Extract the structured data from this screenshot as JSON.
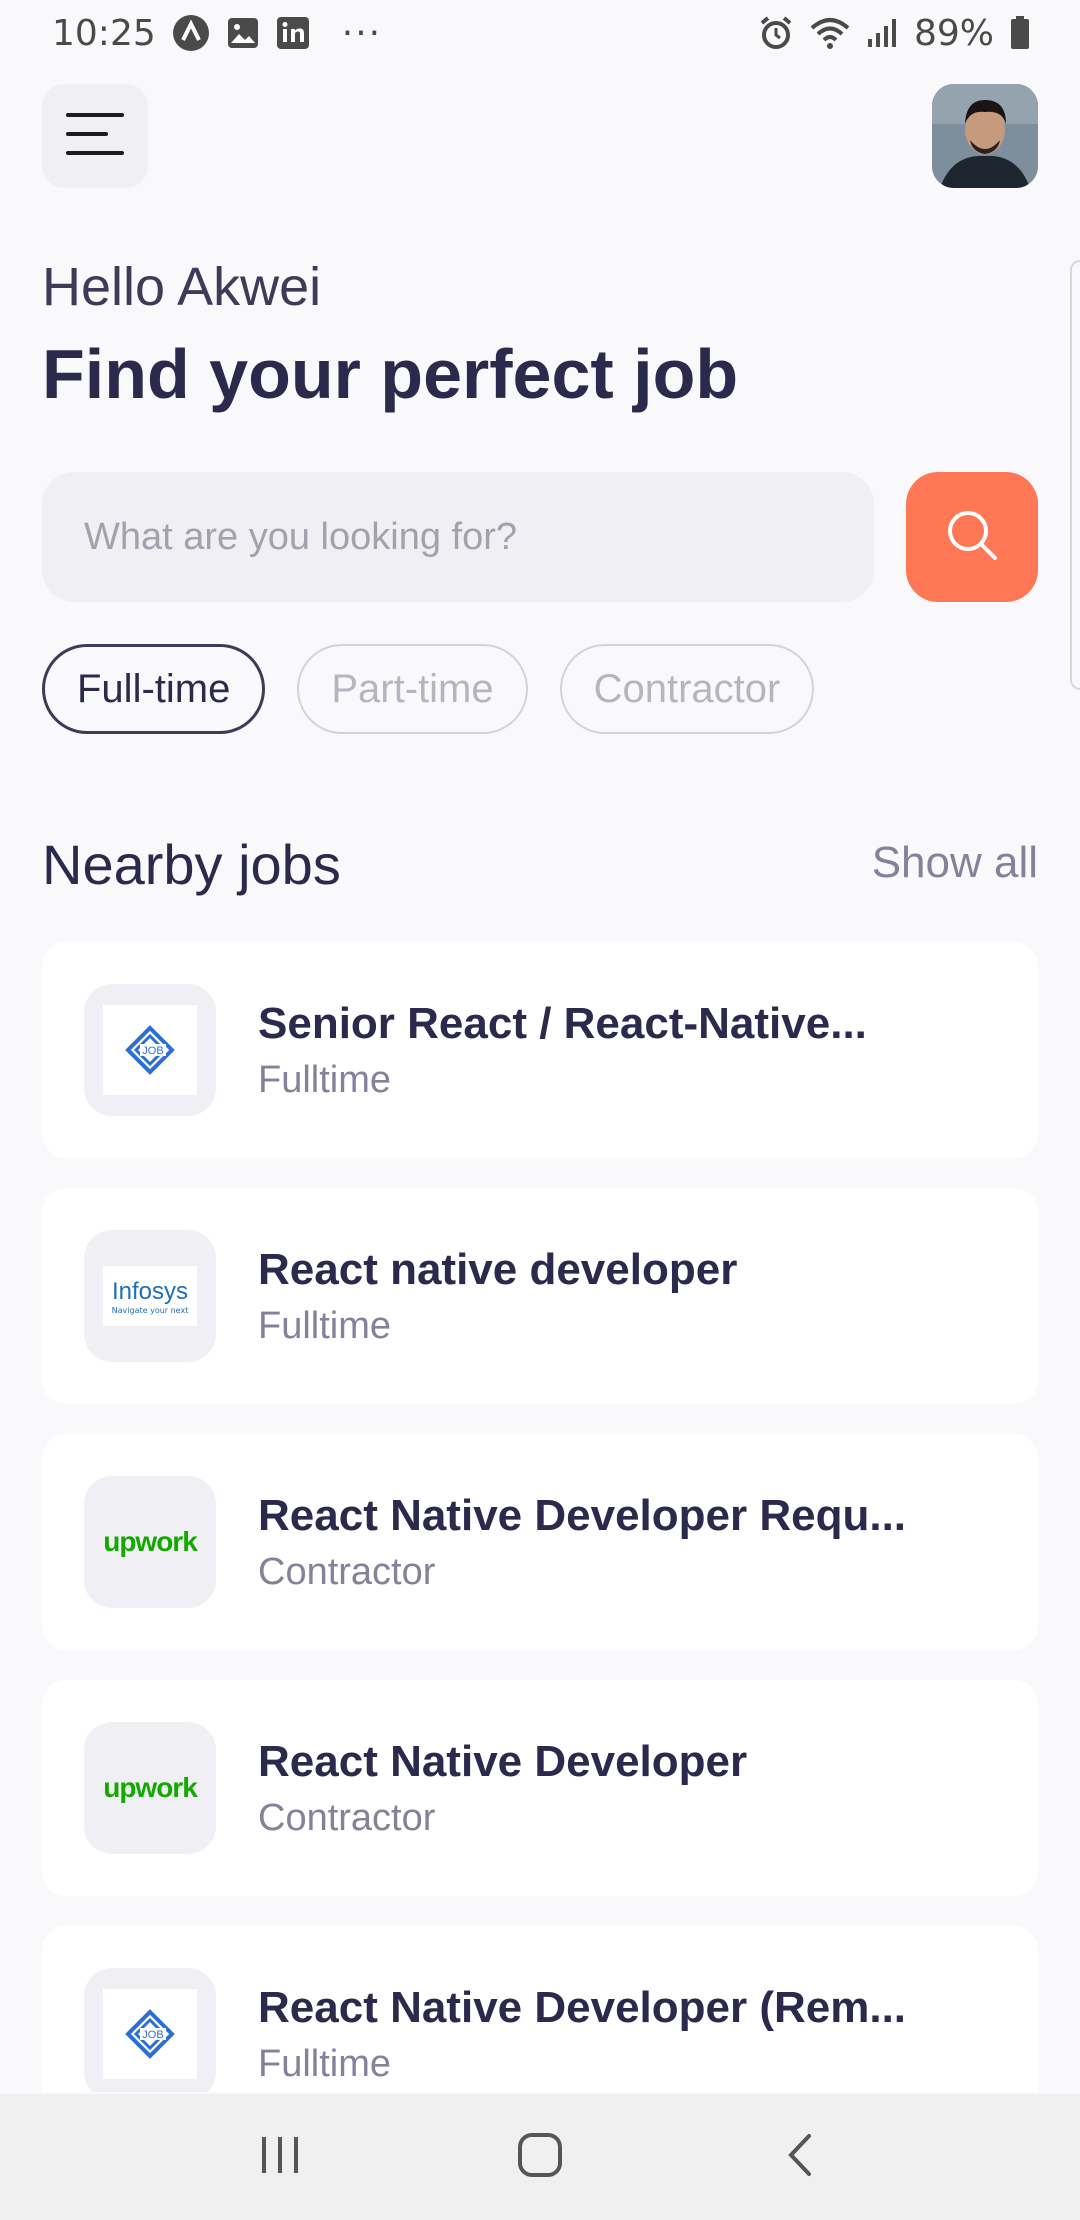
{
  "status_bar": {
    "time": "10:25",
    "dots": "···",
    "battery": "89%",
    "icons": [
      "app-icon",
      "image-icon",
      "linkedin-icon",
      "alarm-icon",
      "wifi-icon",
      "signal-icon",
      "battery-icon"
    ]
  },
  "header": {
    "menu_icon": "menu-icon",
    "avatar": "profile-avatar"
  },
  "greeting": "Hello Akwei",
  "headline": "Find your perfect job",
  "search": {
    "placeholder": "What are you looking for?",
    "value": "",
    "button_icon": "search-icon"
  },
  "chips": [
    {
      "label": "Full-time",
      "active": true
    },
    {
      "label": "Part-time",
      "active": false
    },
    {
      "label": "Contractor",
      "active": false
    }
  ],
  "section": {
    "title": "Nearby jobs",
    "show_all": "Show all"
  },
  "jobs": [
    {
      "title": "Senior React / React-Native...",
      "type": "Fulltime",
      "logo": "job-logo"
    },
    {
      "title": "React native developer",
      "type": "Fulltime",
      "logo": "infosys-logo"
    },
    {
      "title": "React Native Developer Requ...",
      "type": "Contractor",
      "logo": "upwork-logo"
    },
    {
      "title": "React Native Developer",
      "type": "Contractor",
      "logo": "upwork-logo"
    },
    {
      "title": "React Native Developer (Rem...",
      "type": "Fulltime",
      "logo": "job-logo"
    }
  ],
  "logo_text": {
    "job": "JOB",
    "infosys": "Infosys",
    "infosys_tagline": "Navigate your next",
    "upwork": "upwork"
  },
  "nav_bar": {
    "icons": [
      "recent-apps-icon",
      "home-icon",
      "back-icon"
    ]
  },
  "colors": {
    "accent": "#ff7754",
    "primary_text": "#2b2a4c",
    "secondary_text": "#83829a",
    "background": "#f9f9fc",
    "upwork_green": "#14a800"
  }
}
